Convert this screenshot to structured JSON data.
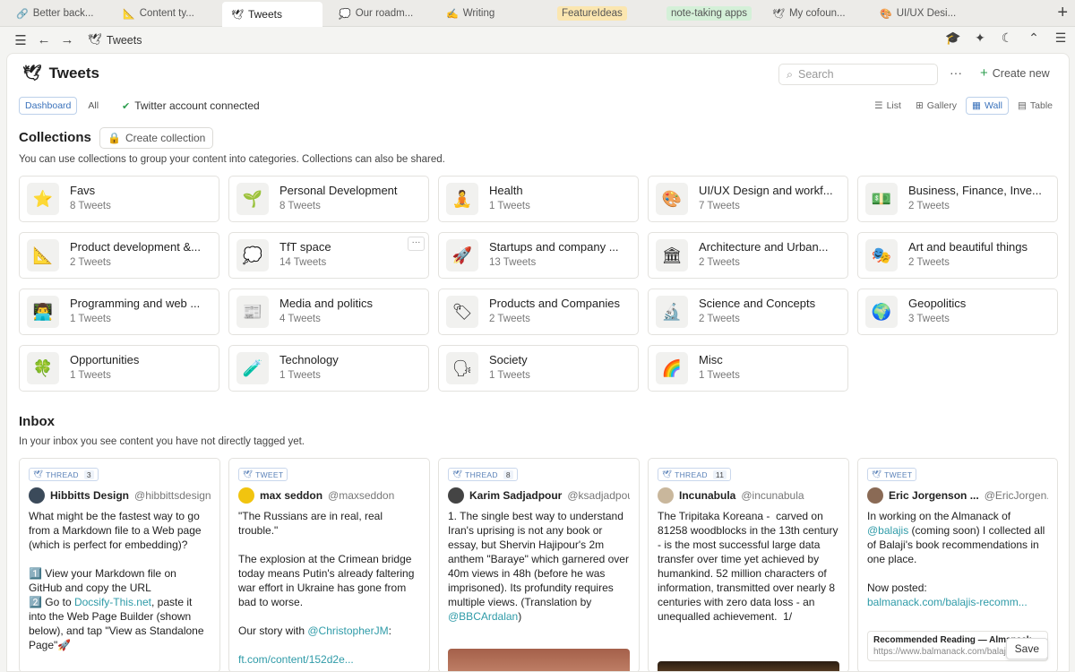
{
  "tabs": [
    {
      "label": "Better back...",
      "icon": "🔗"
    },
    {
      "label": "Content ty...",
      "icon": "📐"
    },
    {
      "label": "Tweets",
      "icon": "🕊",
      "active": true
    },
    {
      "label": "Our roadm...",
      "icon": "💭"
    },
    {
      "label": "Writing",
      "icon": "✍"
    },
    {
      "label": "FeatureIdeas",
      "highlight": "#fbe6b0"
    },
    {
      "label": "note-taking apps",
      "highlight": "#d4f0d8"
    },
    {
      "label": "My cofoun...",
      "icon": "🕊"
    },
    {
      "label": "UI/UX Desi...",
      "icon": "🎨"
    }
  ],
  "nav": {
    "crumb": "Tweets"
  },
  "header": {
    "title": "Tweets",
    "search_placeholder": "Search",
    "more": "···",
    "create_new": "Create new"
  },
  "filters": {
    "dashboard": "Dashboard",
    "all": "All",
    "connected": "Twitter account connected",
    "views": [
      {
        "label": "List",
        "icon": "☰"
      },
      {
        "label": "Gallery",
        "icon": "⊞"
      },
      {
        "label": "Wall",
        "icon": "▦",
        "active": true
      },
      {
        "label": "Table",
        "icon": "▤"
      }
    ]
  },
  "collections": {
    "title": "Collections",
    "create_label": "Create collection",
    "description": "You can use collections to group your content into categories. Collections can also be shared.",
    "items": [
      {
        "emoji": "⭐",
        "name": "Favs",
        "count": "8 Tweets"
      },
      {
        "emoji": "🌱",
        "name": "Personal Development",
        "count": "8 Tweets"
      },
      {
        "emoji": "🧘",
        "name": "Health",
        "count": "1 Tweets"
      },
      {
        "emoji": "🎨",
        "name": "UI/UX Design and workf...",
        "count": "7 Tweets"
      },
      {
        "emoji": "💵",
        "name": "Business, Finance, Inve...",
        "count": "2 Tweets"
      },
      {
        "emoji": "📐",
        "name": "Product development &...",
        "count": "2 Tweets"
      },
      {
        "emoji": "💭",
        "name": "TfT space",
        "count": "14 Tweets",
        "hover": true
      },
      {
        "emoji": "🚀",
        "name": "Startups and company ...",
        "count": "13 Tweets"
      },
      {
        "emoji": "🏛",
        "name": "Architecture and Urban...",
        "count": "2 Tweets"
      },
      {
        "emoji": "🎭",
        "name": "Art and beautiful things",
        "count": "2 Tweets"
      },
      {
        "emoji": "👨‍💻",
        "name": "Programming and web ...",
        "count": "1 Tweets"
      },
      {
        "emoji": "📰",
        "name": "Media and politics",
        "count": "4 Tweets"
      },
      {
        "emoji": "🏷",
        "name": "Products and Companies",
        "count": "2 Tweets"
      },
      {
        "emoji": "🔬",
        "name": "Science and Concepts",
        "count": "2 Tweets"
      },
      {
        "emoji": "🌍",
        "name": "Geopolitics",
        "count": "3 Tweets"
      },
      {
        "emoji": "🍀",
        "name": "Opportunities",
        "count": "1 Tweets"
      },
      {
        "emoji": "🧪",
        "name": "Technology",
        "count": "1 Tweets"
      },
      {
        "emoji": "🗣",
        "name": "Society",
        "count": "1 Tweets"
      },
      {
        "emoji": "🌈",
        "name": "Misc",
        "count": "1 Tweets"
      }
    ],
    "card_more": "···"
  },
  "inbox": {
    "title": "Inbox",
    "description": "In your inbox you see content you have not directly tagged yet.",
    "tweets": [
      {
        "type": "THREAD",
        "count": "3",
        "name": "Hibbitts Design",
        "handle": "@hibbittsdesign",
        "avatar_color": "#3b4a5a",
        "segments": [
          {
            "t": "What might be the fastest way to go from a Markdown file to a Web page (which is perfect for embedding)?\n\n1️⃣ View your Markdown file on GitHub and copy the URL\n2️⃣ Go to "
          },
          {
            "t": "Docsify-This.net",
            "link": true
          },
          {
            "t": ", paste it into the Web Page Builder (shown below), and tap \"View as Standalone Page\"🚀"
          }
        ]
      },
      {
        "type": "TWEET",
        "name": "max seddon",
        "handle": "@maxseddon",
        "avatar_color": "#f1c40f",
        "segments": [
          {
            "t": "\"The Russians are in real, real trouble.\"\n\nThe explosion at the Crimean bridge today means Putin's already faltering war effort in Ukraine has gone from bad to worse.\n\nOur story with "
          },
          {
            "t": "@ChristopherJM",
            "link": true
          },
          {
            "t": ":\n\n"
          },
          {
            "t": "ft.com/content/152d2e...",
            "link": true
          }
        ]
      },
      {
        "type": "THREAD",
        "count": "8",
        "name": "Karim Sadjadpour",
        "handle": "@ksadjadpour",
        "avatar_color": "#444444",
        "segments": [
          {
            "t": "1. The single best way to understand Iran's uprising is not any book or essay, but Shervin Hajipour's 2m anthem \"Baraye\" which garnered over 40m views in 48h (before he was imprisoned). Its profundity requires multiple views. (Translation by "
          },
          {
            "t": "@BBCArdalan",
            "link": true
          },
          {
            "t": ")"
          }
        ]
      },
      {
        "type": "THREAD",
        "count": "11",
        "name": "Incunabula",
        "handle": "@incunabula",
        "avatar_color": "#c9b79c",
        "segments": [
          {
            "t": "The Tripitaka Koreana -  carved on 81258 woodblocks in the 13th century - is the most successful large data transfer over time yet achieved by humankind. 52 million characters of information, transmitted over nearly 8 centuries with zero data loss - an unequalled achievement.  1/"
          }
        ]
      },
      {
        "type": "TWEET",
        "name": "Eric Jorgenson ...",
        "handle": "@EricJorgen...",
        "avatar_color": "#8a6a55",
        "segments": [
          {
            "t": "In working on the Almanack of "
          },
          {
            "t": "@balajis",
            "link": true
          },
          {
            "t": " (coming soon) I collected all of Balaji's book recommendations in one place.\n\nNow posted:\n"
          },
          {
            "t": "balmanack.com/balajis-recomm...",
            "link": true
          }
        ],
        "preview_title": "Recommended Reading — Almanack",
        "preview_url": "https://www.balmanack.com/balajis",
        "save": "Save"
      }
    ]
  },
  "colors": {
    "accent": "#3a72bb",
    "link": "#2f9ba8",
    "green": "#2e9e4f"
  }
}
